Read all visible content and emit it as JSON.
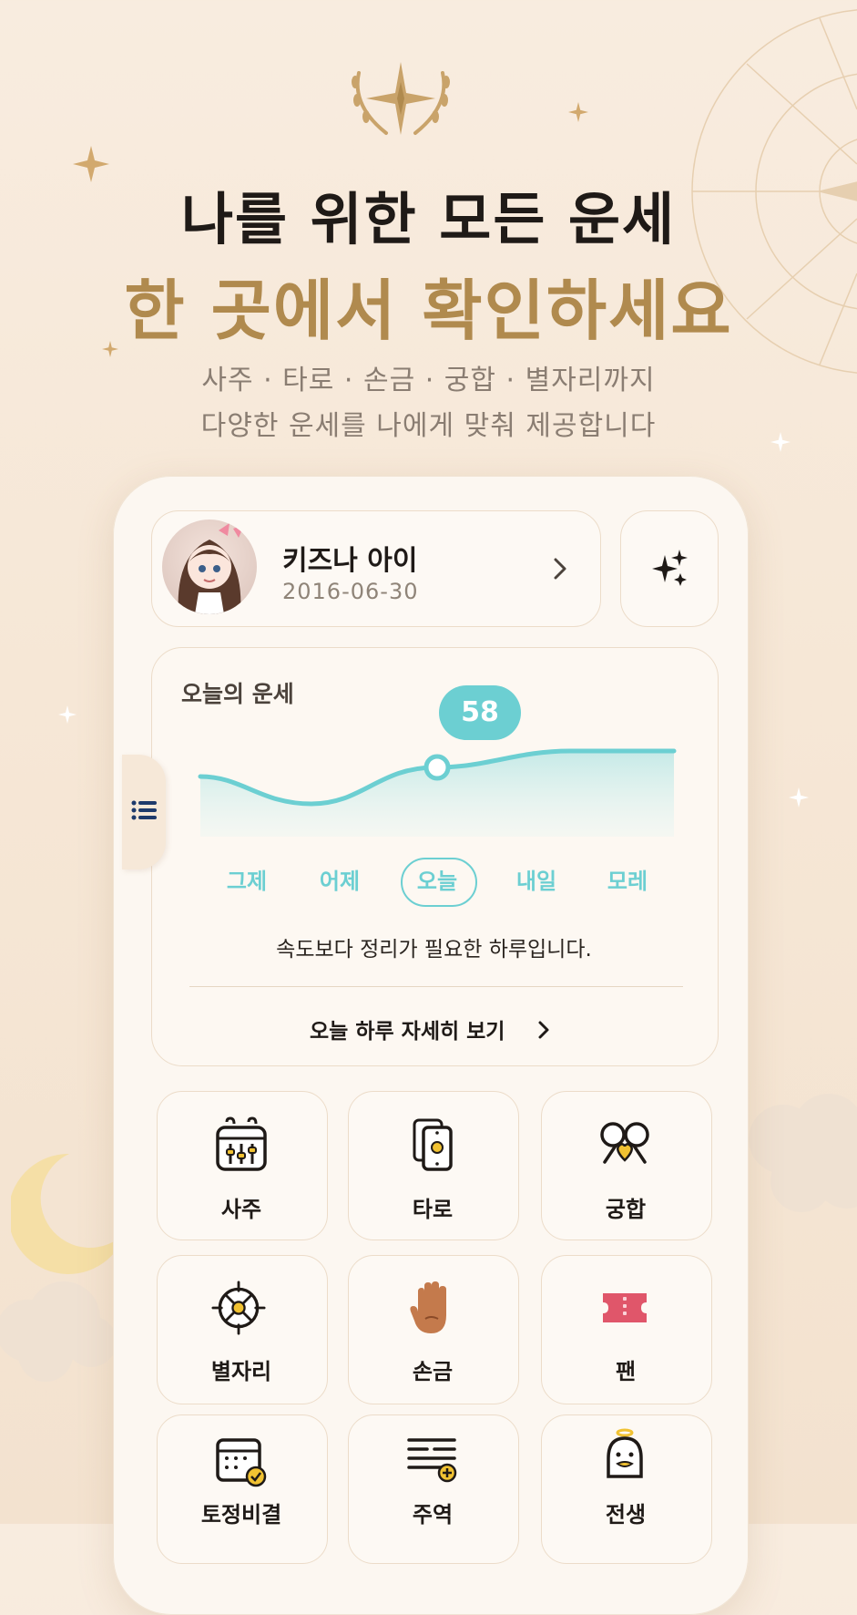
{
  "hero": {
    "title_line1": "나를 위한 모든 운세",
    "title_line2": "한 곳에서 확인하세요",
    "subtitle_line1": "사주 · 타로 · 손금 · 궁합 · 별자리까지",
    "subtitle_line2": "다양한 운세를 나에게 맞춰 제공합니다"
  },
  "profile": {
    "name": "키즈나 아이",
    "birthdate": "2016-06-30"
  },
  "fortune": {
    "label": "오늘의 운세",
    "score": "58",
    "days": [
      "그제",
      "어제",
      "오늘",
      "내일",
      "모레"
    ],
    "selected_day": "오늘",
    "message": "속도보다 정리가 필요한 하루입니다.",
    "detail_link": "오늘 하루 자세히 보기"
  },
  "menu": [
    {
      "label": "사주",
      "icon": "calendar-sliders-icon"
    },
    {
      "label": "타로",
      "icon": "tarot-cards-icon"
    },
    {
      "label": "궁합",
      "icon": "couple-heart-icon"
    },
    {
      "label": "별자리",
      "icon": "constellation-icon"
    },
    {
      "label": "손금",
      "icon": "palm-icon"
    },
    {
      "label": "팬",
      "icon": "ticket-icon"
    },
    {
      "label": "토정비결",
      "icon": "calendar-check-icon"
    },
    {
      "label": "주역",
      "icon": "hexagram-icon"
    },
    {
      "label": "전생",
      "icon": "spirit-icon"
    }
  ],
  "colors": {
    "accent": "#6ccfd2",
    "gold": "#b08a4e",
    "background": "#f8ecdf"
  }
}
